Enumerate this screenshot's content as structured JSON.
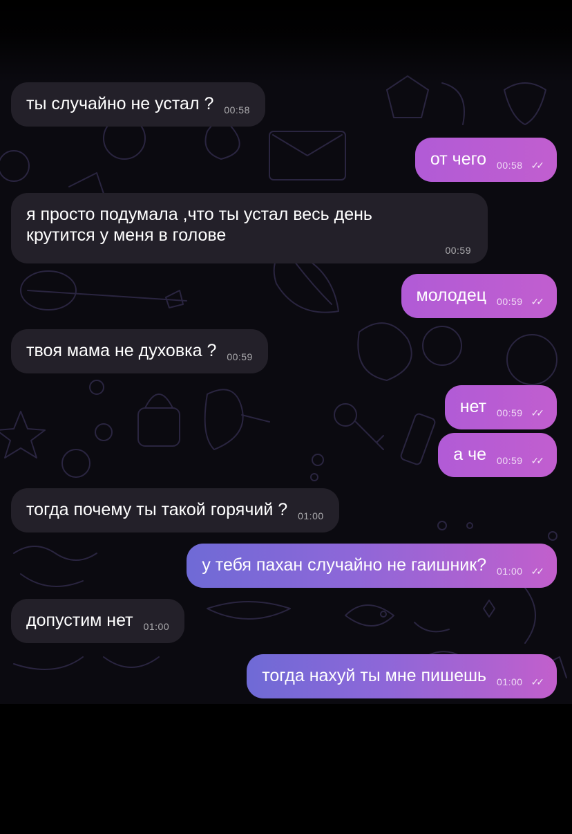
{
  "chat": {
    "messages": [
      {
        "side": "in",
        "text": "ты случайно не устал ?",
        "time": "00:58"
      },
      {
        "side": "out",
        "text": "от чего",
        "time": "00:58"
      },
      {
        "side": "in",
        "text_line1": "я просто подумала ,что ты устал весь день",
        "text_line2": "крутится у меня в голове",
        "time": "00:59"
      },
      {
        "side": "out",
        "text": "молодец",
        "time": "00:59"
      },
      {
        "side": "in",
        "text": "твоя мама не духовка ?",
        "time": "00:59"
      },
      {
        "side": "out",
        "text": "нет",
        "time": "00:59"
      },
      {
        "side": "out",
        "text": "а че",
        "time": "00:59"
      },
      {
        "side": "in",
        "text": "тогда почему ты такой горячий ?",
        "time": "01:00"
      },
      {
        "side": "out",
        "text": "у тебя пахан случайно не гаишник?",
        "time": "01:00"
      },
      {
        "side": "in",
        "text": "допустим нет",
        "time": "01:00"
      },
      {
        "side": "out",
        "text": "тогда нахуй ты мне пишешь",
        "time": "01:00"
      }
    ],
    "read_mark": "✓✓",
    "colors": {
      "incoming_bubble": "#232029",
      "outgoing_bubble": "#c15ecf",
      "outgoing_gradient_start": "#6f6ad6",
      "background": "#0b0a10"
    }
  }
}
